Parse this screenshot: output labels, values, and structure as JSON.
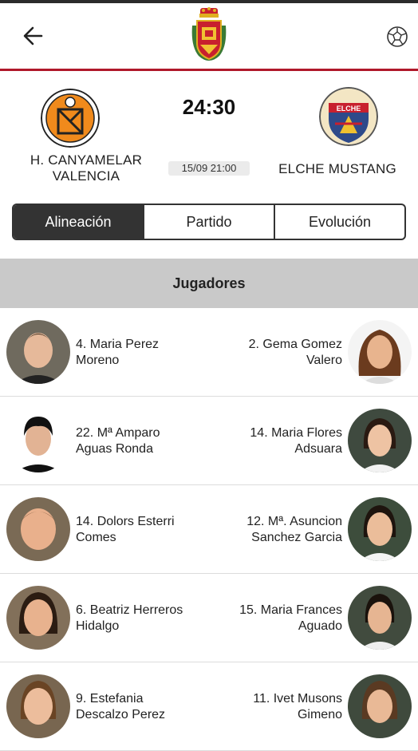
{
  "appbar": {
    "back_icon": "arrow-left-icon",
    "crest_icon": "municipal-crest-icon",
    "ball_icon": "handball-icon"
  },
  "match": {
    "home_team": "H. CANYAMELAR VALENCIA",
    "away_team": "ELCHE MUSTANG",
    "away_logo_text": "ELCHE",
    "score": "24:30",
    "datetime": "15/09 21:00"
  },
  "tabs": [
    {
      "label": "Alineación",
      "active": true
    },
    {
      "label": "Partido",
      "active": false
    },
    {
      "label": "Evolución",
      "active": false
    }
  ],
  "section": {
    "title": "Jugadores"
  },
  "players": [
    {
      "home": {
        "line1": "4. Maria Perez",
        "line2": "Moreno"
      },
      "away": {
        "line1": "2. Gema Gomez",
        "line2": "Valero"
      }
    },
    {
      "home": {
        "line1": "22. Mª Amparo",
        "line2": "Aguas Ronda"
      },
      "away": {
        "line1": "14. Maria Flores",
        "line2": "Adsuara"
      }
    },
    {
      "home": {
        "line1": "14. Dolors Esterri",
        "line2": "Comes"
      },
      "away": {
        "line1": "12. Mª. Asuncion",
        "line2": "Sanchez Garcia"
      }
    },
    {
      "home": {
        "line1": "6. Beatriz Herreros",
        "line2": "Hidalgo"
      },
      "away": {
        "line1": "15. Maria Frances",
        "line2": "Aguado"
      }
    },
    {
      "home": {
        "line1": "9. Estefania",
        "line2": "Descalzo Perez"
      },
      "away": {
        "line1": "11. Ivet Musons",
        "line2": "Gimeno"
      }
    }
  ],
  "colors": {
    "accent_line": "#b0182a",
    "tab_active_bg": "#333333",
    "section_bg": "#c9c9c9"
  }
}
